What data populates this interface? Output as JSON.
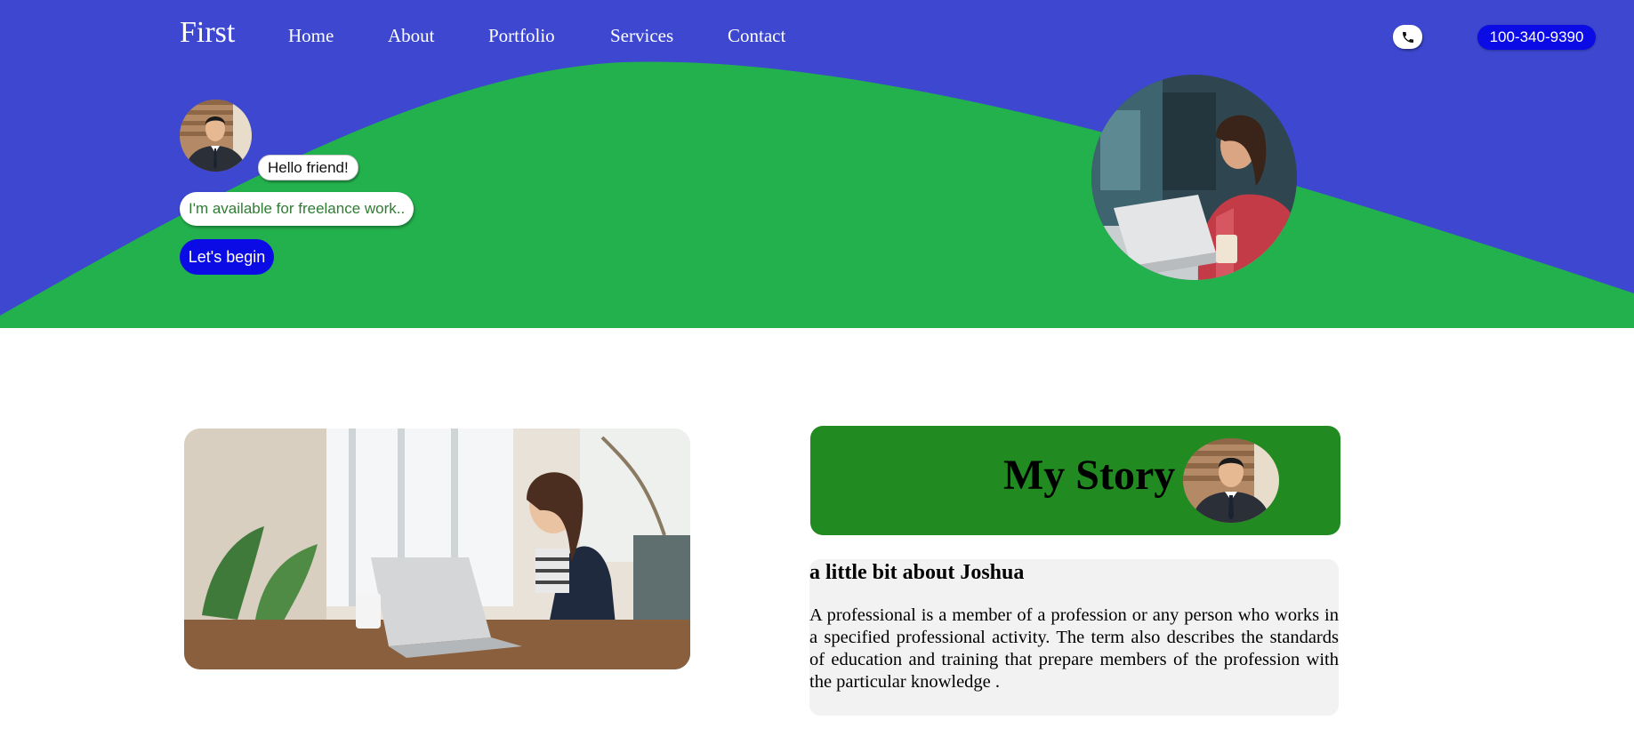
{
  "header": {
    "brand": "First",
    "nav": [
      {
        "label": "Home"
      },
      {
        "label": "About"
      },
      {
        "label": "Portfolio"
      },
      {
        "label": "Services"
      },
      {
        "label": "Contact"
      }
    ],
    "phone_icon": "phone-icon",
    "phone_number": "100-340-9390"
  },
  "hero": {
    "greeting": "Hello friend!",
    "tagline": "I'm available for freelance work..",
    "cta_label": "Let's begin"
  },
  "story": {
    "title": "My Story",
    "heading": "a little bit about Joshua",
    "body": "A professional is a member of a profession or any person who works in a specified professional activity. The term also describes the standards of education and training that prepare members of the profession with the particular knowledge ."
  },
  "colors": {
    "hero_blue": "#3d47cf",
    "hero_green": "#23b14d",
    "button_blue": "#0b0be6",
    "story_green": "#218b21",
    "about_bg": "#f2f2f2"
  }
}
